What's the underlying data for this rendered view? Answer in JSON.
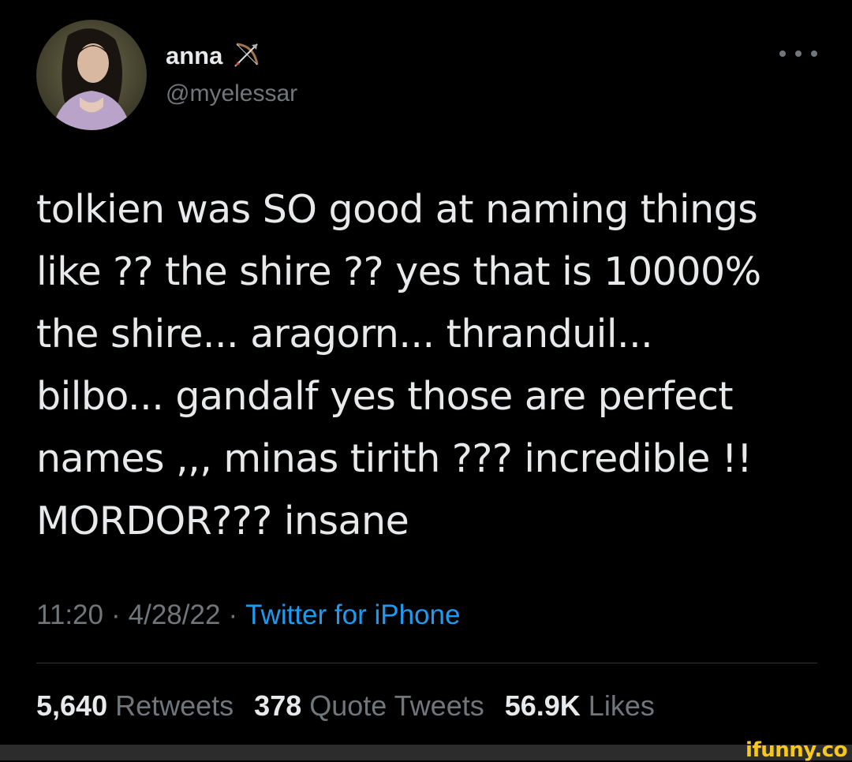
{
  "user": {
    "display_name": "anna",
    "handle": "@myelessar",
    "name_emoji_icon": "bow-and-arrow-icon"
  },
  "tweet": {
    "lines": [
      "tolkien was SO good at naming things",
      "like ?? the shire ?? yes that is 10000%",
      "the shire... aragorn... thranduil...",
      "bilbo... gandalf  yes those are perfect",
      "names ,,, minas tirith ??? incredible !!",
      "MORDOR??? insane"
    ]
  },
  "meta": {
    "time": "11:20",
    "separator": "·",
    "date": "4/28/22",
    "source": "Twitter for iPhone"
  },
  "stats": {
    "retweets_count": "5,640",
    "retweets_label": "Retweets",
    "quotes_count": "378",
    "quotes_label": "Quote Tweets",
    "likes_count": "56.9K",
    "likes_label": "Likes"
  },
  "watermark": "ifunny.co",
  "colors": {
    "background": "#000000",
    "text_primary": "#e7e9ea",
    "text_secondary": "#71767b",
    "link": "#1d9bf0",
    "watermark": "#f6c81f"
  }
}
